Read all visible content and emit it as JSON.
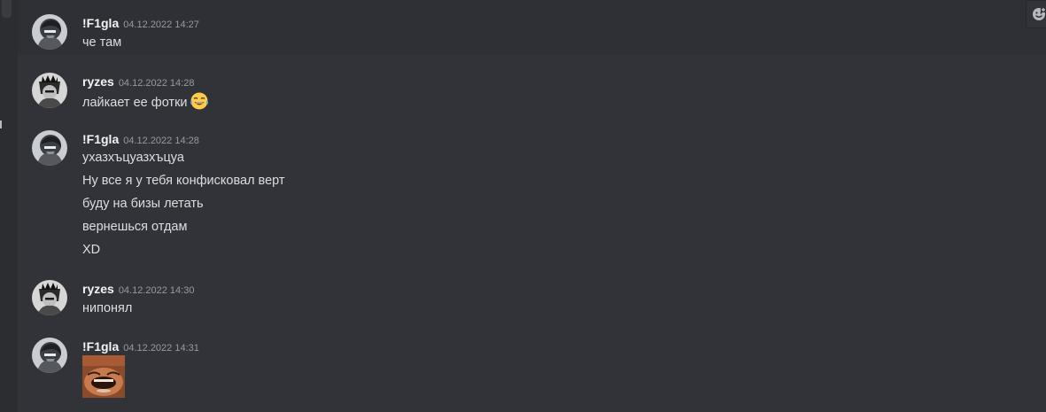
{
  "messages": [
    {
      "author": "!F1gla",
      "timestamp": "04.12.2022 14:27",
      "avatar": "f1gla-avatar",
      "lines": [
        "че там"
      ]
    },
    {
      "author": "ryzes",
      "timestamp": "04.12.2022 14:28",
      "avatar": "ryzes-avatar",
      "lines": [
        "лайкает ее фотки"
      ],
      "emoji": "joy-emoji"
    },
    {
      "author": "!F1gla",
      "timestamp": "04.12.2022 14:28",
      "avatar": "f1gla-avatar",
      "lines": [
        "ухазхъцуазхъцуа",
        "Ну все я у тебя конфисковал верт",
        "буду на бизы летать",
        "вернешься отдам",
        "XD"
      ]
    },
    {
      "author": "ryzes",
      "timestamp": "04.12.2022 14:30",
      "avatar": "ryzes-avatar",
      "lines": [
        "нипонял"
      ]
    },
    {
      "author": "!F1gla",
      "timestamp": "04.12.2022 14:31",
      "avatar": "f1gla-avatar",
      "lines": [],
      "sticker": "laughing-man-sticker"
    }
  ],
  "colors": {
    "background": "#313338",
    "hover": "#2e3035",
    "username": "#f2f3f5",
    "timestamp": "#949ba4",
    "text": "#dbdee1"
  },
  "toolbar": {
    "icon": "add-reaction-icon"
  }
}
